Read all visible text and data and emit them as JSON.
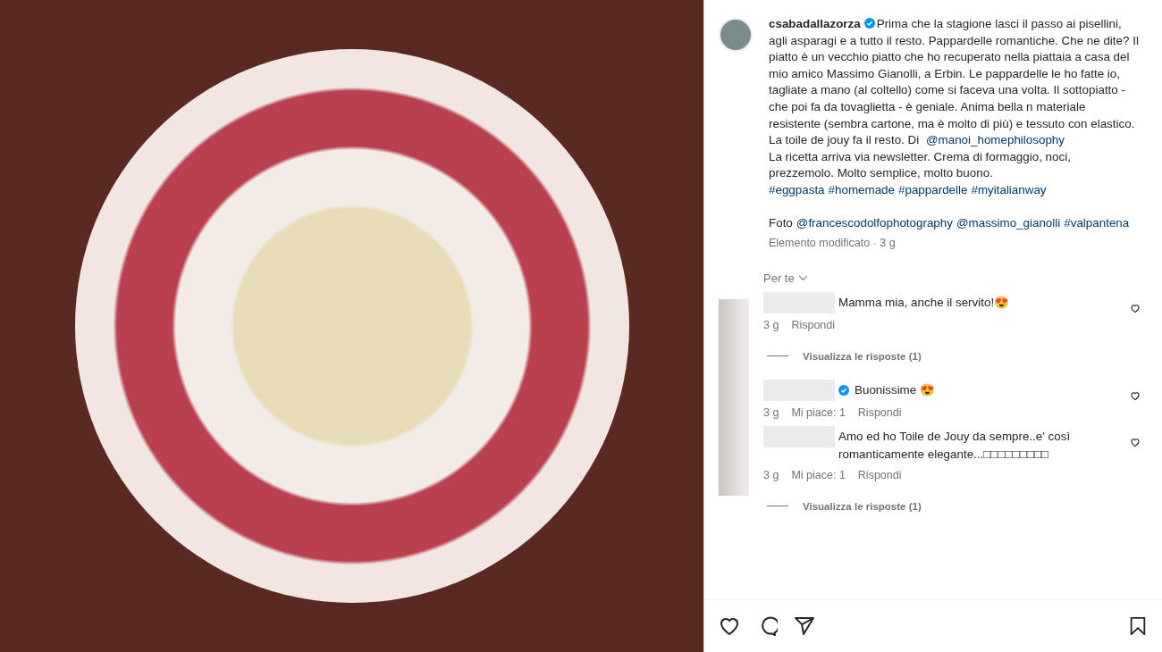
{
  "post": {
    "username": "csabadallazorza",
    "verified": true,
    "caption": [
      [
        {
          "kind": "text",
          "text": "Prima che la stagione lasci il passo ai pisellini, agli asparagi e a tutto il resto. Pappardelle romantiche. Che ne dite? Il piatto è un vecchio piatto che ho recuperato nella piattaia a casa del mio amico Massimo Gianolli, a Erbin. Le pappardelle le ho fatte io, tagliate a mano (al coltello) come si faceva una volta. Il sottopiatto - che poi fa da tovaglietta - è geniale. Anima bella n materiale resistente (sembra cartone, ma è molto di più) e tessuto con elastico. La toile de jouy fa il resto. Di "
        },
        {
          "kind": "link",
          "text": "@manoi_homephilosophy"
        }
      ],
      [
        {
          "kind": "text",
          "text": "La ricetta arriva via newsletter. Crema di formaggio, noci, prezzemolo. Molto semplice, molto buono."
        }
      ],
      [
        {
          "kind": "link",
          "text": "#eggpasta"
        },
        {
          "kind": "link",
          "text": "#homemade"
        },
        {
          "kind": "link",
          "text": "#pappardelle"
        },
        {
          "kind": "link",
          "text": "#myitalianway"
        }
      ],
      [
        {
          "kind": "text",
          "text": "Foto"
        },
        {
          "kind": "link",
          "text": "@francescodolfophotography"
        },
        {
          "kind": "link",
          "text": "@massimo_gianolli"
        },
        {
          "kind": "link",
          "text": "#valpantena"
        }
      ]
    ],
    "edited": "Elemento modificato · 3 g"
  },
  "sort": {
    "label": "Per te"
  },
  "comments": [
    {
      "verified": false,
      "text": "Mamma mia, anche il servito!😍",
      "time": "3 g",
      "reply": "Rispondi",
      "view_replies": "Visualizza le risposte (1)"
    },
    {
      "verified": true,
      "text": "Buonissime 😍",
      "time": "3 g",
      "likes": "Mi piace: 1",
      "reply": "Rispondi"
    },
    {
      "verified": false,
      "text": "Amo ed ho Toile de Jouy da sempre..e' così romanticamente elegante...□□□□□□□□□",
      "time": "3 g",
      "likes": "Mi piace: 1",
      "reply": "Rispondi",
      "view_replies": "Visualizza le risposte (1)"
    }
  ]
}
